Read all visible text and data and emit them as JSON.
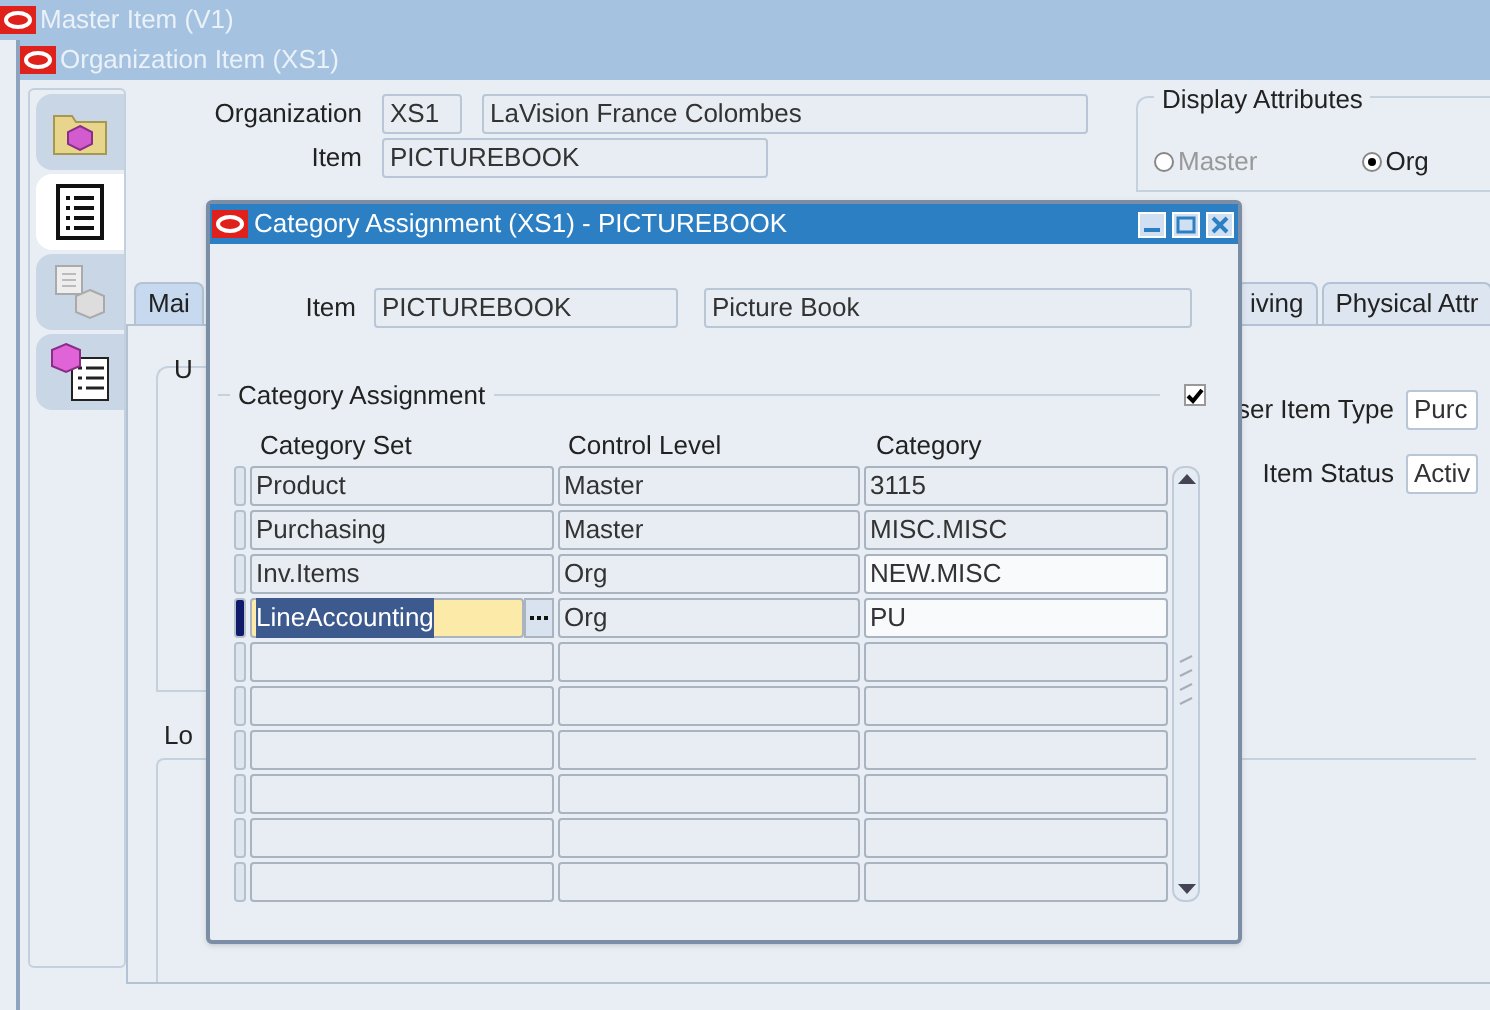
{
  "master_window": {
    "title": "Master Item (V1)"
  },
  "org_window": {
    "title": "Organization Item (XS1)",
    "sidebar": [
      {
        "kind": "folder",
        "selected": false
      },
      {
        "kind": "list",
        "selected": true
      },
      {
        "kind": "document",
        "selected": false
      },
      {
        "kind": "cube-list",
        "selected": false
      }
    ],
    "organization": {
      "label": "Organization",
      "code": "XS1",
      "name": "LaVision France Colombes"
    },
    "item": {
      "label": "Item",
      "value": "PICTUREBOOK"
    },
    "display_attributes": {
      "title": "Display Attributes",
      "options": [
        {
          "label": "Master",
          "selected": false,
          "disabled": true
        },
        {
          "label": "Org",
          "selected": true,
          "disabled": false
        }
      ]
    },
    "tabs": [
      {
        "label": "Mai",
        "selected": true
      },
      {
        "label": "iving",
        "selected": false
      },
      {
        "label": "Physical Attr",
        "selected": false
      }
    ],
    "group_label": "U",
    "fields": [
      {
        "label": "ser Item Type",
        "value": "Purc"
      },
      {
        "label": "Item Status",
        "value": "Activ"
      }
    ],
    "lower_label": "Lo"
  },
  "dialog": {
    "title": "Category Assignment (XS1) - PICTUREBOOK",
    "item": {
      "label": "Item",
      "code": "PICTUREBOOK",
      "description": "Picture Book"
    },
    "section": {
      "title": "Category Assignment",
      "checked": true
    },
    "columns": [
      "Category Set",
      "Control Level",
      "Category"
    ],
    "rows": [
      {
        "category_set": "Product",
        "control_level": "Master",
        "category": "3115",
        "current": false,
        "category_editable": false
      },
      {
        "category_set": "Purchasing",
        "control_level": "Master",
        "category": "MISC.MISC",
        "current": false,
        "category_editable": false
      },
      {
        "category_set": "Inv.Items",
        "control_level": "Org",
        "category": "NEW.MISC",
        "current": false,
        "category_editable": true
      },
      {
        "category_set": "LineAccounting",
        "control_level": "Org",
        "category": "PU",
        "current": true,
        "category_editable": true
      },
      {
        "current": false,
        "category_editable": false
      },
      {
        "current": false,
        "category_editable": false
      },
      {
        "current": false,
        "category_editable": false
      },
      {
        "current": false,
        "category_editable": false
      },
      {
        "current": false,
        "category_editable": false
      },
      {
        "current": false,
        "category_editable": false
      }
    ]
  }
}
